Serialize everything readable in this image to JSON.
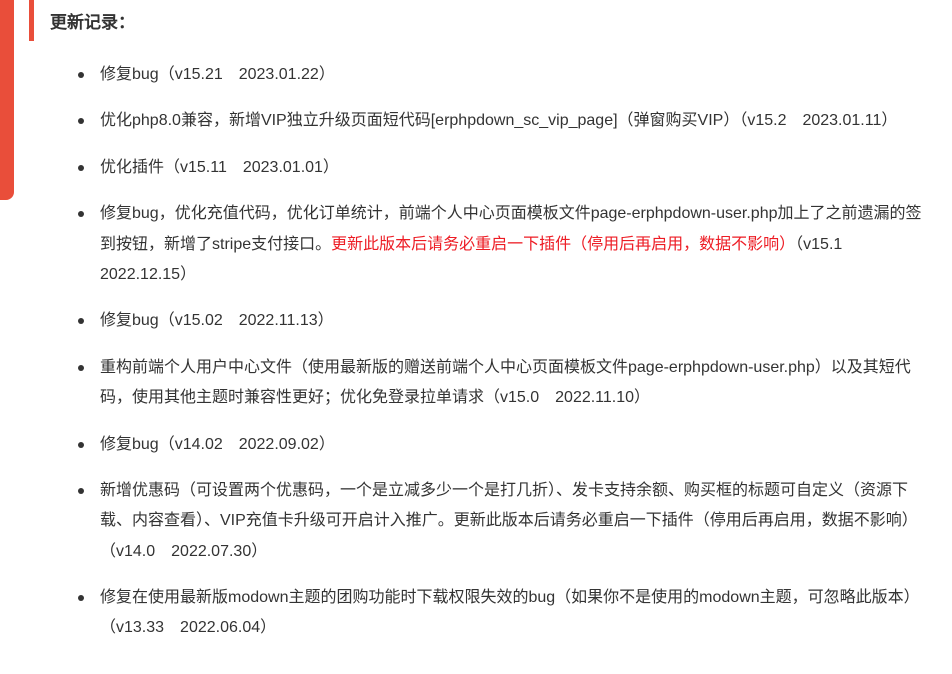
{
  "header": {
    "title": "更新记录："
  },
  "changelog": [
    {
      "text": "修复bug（v15.21　2023.01.22）"
    },
    {
      "text": "优化php8.0兼容，新增VIP独立升级页面短代码[erphpdown_sc_vip_page]（弹窗购买VIP）（v15.2　2023.01.11）"
    },
    {
      "text": "优化插件（v15.11　2023.01.01）"
    },
    {
      "part1": "修复bug，优化充值代码，优化订单统计，前端个人中心页面模板文件page-erphpdown-user.php加上了之前遗漏的签到按钮，新增了stripe支付接口。",
      "highlight": "更新此版本后请务必重启一下插件（停用后再启用，数据不影响）",
      "part2": "（v15.1　2022.12.15）"
    },
    {
      "text": "修复bug（v15.02　2022.11.13）"
    },
    {
      "text": "重构前端个人用户中心文件（使用最新版的赠送前端个人中心页面模板文件page-erphpdown-user.php）以及其短代码，使用其他主题时兼容性更好；优化免登录拉单请求（v15.0　2022.11.10）"
    },
    {
      "text": "修复bug（v14.02　2022.09.02）"
    },
    {
      "text": "新增优惠码（可设置两个优惠码，一个是立减多少一个是打几折）、发卡支持余额、购买框的标题可自定义（资源下载、内容查看）、VIP充值卡升级可开启计入推广。更新此版本后请务必重启一下插件（停用后再启用，数据不影响）（v14.0　2022.07.30）"
    },
    {
      "text": "修复在使用最新版modown主题的团购功能时下载权限失效的bug（如果你不是使用的modown主题，可忽略此版本）（v13.33　2022.06.04）"
    }
  ]
}
